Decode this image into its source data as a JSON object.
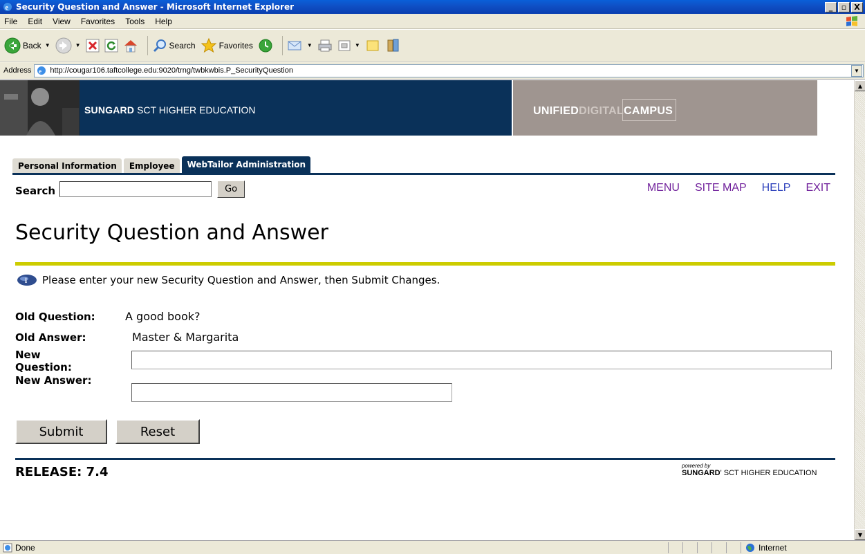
{
  "window": {
    "title": "Security Question and Answer - Microsoft Internet Explorer",
    "controls": [
      "_",
      "▫",
      "X"
    ]
  },
  "menu": [
    "File",
    "Edit",
    "View",
    "Favorites",
    "Tools",
    "Help"
  ],
  "toolbar": {
    "back_label": "Back",
    "search_label": "Search",
    "favorites_label": "Favorites"
  },
  "address": {
    "label": "Address",
    "url": "http://cougar106.taftcollege.edu:9020/trng/twbkwbis.P_SecurityQuestion"
  },
  "banner": {
    "brand_bold": "SUNGARD",
    "brand_rest": " SCT HIGHER EDUCATION",
    "udc_part1": "UNIFIED",
    "udc_part2": "DIGITAL",
    "udc_part3": "CAMPUS"
  },
  "tabs": [
    {
      "label": "Personal Information",
      "active": false
    },
    {
      "label": "Employee",
      "active": false
    },
    {
      "label": "WebTailor Administration",
      "active": true
    }
  ],
  "search": {
    "label": "Search",
    "value": "",
    "go_label": "Go"
  },
  "top_links": {
    "menu": "MENU",
    "site_map": "SITE MAP",
    "help": "HELP",
    "exit": "EXIT"
  },
  "page": {
    "title": "Security Question and Answer",
    "info": "Please enter your new Security Question and Answer, then Submit Changes."
  },
  "form": {
    "old_question_label": "Old Question:",
    "old_question_value": "A good book?",
    "old_answer_label": "Old Answer:",
    "old_answer_value": "Master & Margarita",
    "new_question_label_1": "New",
    "new_question_label_2": "Question:",
    "new_question_value": "",
    "new_answer_label": "New Answer:",
    "new_answer_value": ""
  },
  "buttons": {
    "submit": "Submit",
    "reset": "Reset"
  },
  "footer": {
    "release": "RELEASE: 7.4",
    "powered_by": "powered by",
    "brand_bold": "SUNGARD",
    "brand_rest": "' SCT HIGHER EDUCATION"
  },
  "status": {
    "text": "Done",
    "zone": "Internet"
  }
}
